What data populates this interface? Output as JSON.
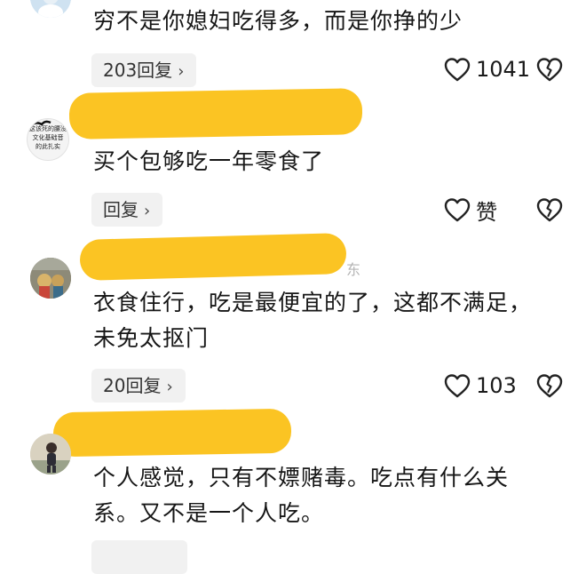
{
  "comments": [
    {
      "text_lines": [
        "穷不是你媳妇吃得多，而是你挣的少"
      ],
      "reply_label": "203回复",
      "likes": "1041"
    },
    {
      "text_lines": [
        "买个包够吃一年零食了"
      ],
      "reply_label": "回复",
      "likes": "赞",
      "avatar_text": [
        "这该死的腰没",
        "文化基础音",
        "的此扎实"
      ]
    },
    {
      "text_lines": [
        "衣食住行，吃是最便宜的了，这都不满足，",
        "未免太抠门"
      ],
      "reply_label": "20回复",
      "likes": "103",
      "residual_char": "东"
    },
    {
      "text_lines": [
        "个人感觉，只有不嫖赌毒。吃点有什么关",
        "系。又不是一个人吃。"
      ]
    }
  ],
  "icons": {
    "like": "heart-outline-icon",
    "dislike": "broken-heart-icon",
    "chevron": "chevron-right-icon"
  },
  "colors": {
    "censor": "#fbc21a",
    "reply_bg": "#f1f1f1",
    "text": "#161616"
  }
}
